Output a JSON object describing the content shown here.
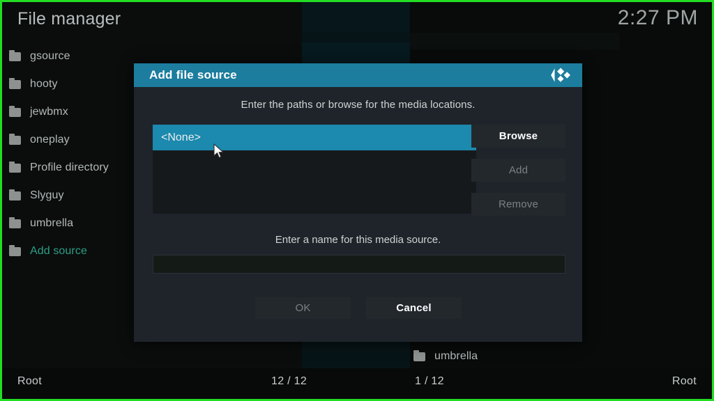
{
  "app": {
    "title": "File manager",
    "clock": "2:27 PM"
  },
  "sidebar": {
    "items": [
      {
        "label": "gsource",
        "icon": "folder-icon",
        "accent": false
      },
      {
        "label": "hooty",
        "icon": "folder-icon",
        "accent": false
      },
      {
        "label": "jewbmx",
        "icon": "folder-icon",
        "accent": false
      },
      {
        "label": "oneplay",
        "icon": "folder-icon",
        "accent": false
      },
      {
        "label": "Profile directory",
        "icon": "folder-icon",
        "accent": false
      },
      {
        "label": "Slyguy",
        "icon": "folder-icon",
        "accent": false
      },
      {
        "label": "umbrella",
        "icon": "folder-icon",
        "accent": false
      },
      {
        "label": "Add source",
        "icon": "folder-icon",
        "accent": true
      }
    ]
  },
  "right_pane": {
    "visible_item": "umbrella"
  },
  "statusbar": {
    "left_path": "Root",
    "left_count": "12 / 12",
    "right_count": "1 / 12",
    "right_path": "Root"
  },
  "dialog": {
    "title": "Add file source",
    "logo_icon": "kodi-logo-icon",
    "instruction": "Enter the paths or browse for the media locations.",
    "path_list": [
      {
        "label": "<None>",
        "selected": true
      }
    ],
    "buttons": {
      "browse": "Browse",
      "add": "Add",
      "remove": "Remove",
      "ok": "OK",
      "cancel": "Cancel"
    },
    "name_label": "Enter a name for this media source.",
    "name_input_value": "",
    "name_input_placeholder": ""
  },
  "colors": {
    "accent_teal": "#1c7d9e",
    "selection_teal": "#1c89ae",
    "dialog_bg": "#1e242a",
    "screen_border_green": "#22dd22",
    "sidebar_accent_text": "#2e9e86"
  }
}
